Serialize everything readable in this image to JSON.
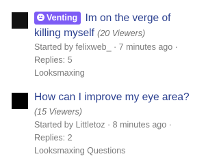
{
  "threads": [
    {
      "badge": "Venting",
      "title_part1": "Im on the verge of",
      "title_part2": "killing myself",
      "viewers": "(20 Viewers)",
      "started_by_prefix": "Started by ",
      "author": "felixweb_",
      "time": " · 7 minutes ago ·",
      "replies": "Replies: 5",
      "forum": "Looksmaxing"
    },
    {
      "title": "How can I improve my eye area?",
      "viewers": "(15 Viewers)",
      "started_by_prefix": "Started by ",
      "author": "Littletoz",
      "time": " · 8 minutes ago ·",
      "replies": "Replies: 2",
      "forum": "Looksmaxing Questions"
    }
  ]
}
